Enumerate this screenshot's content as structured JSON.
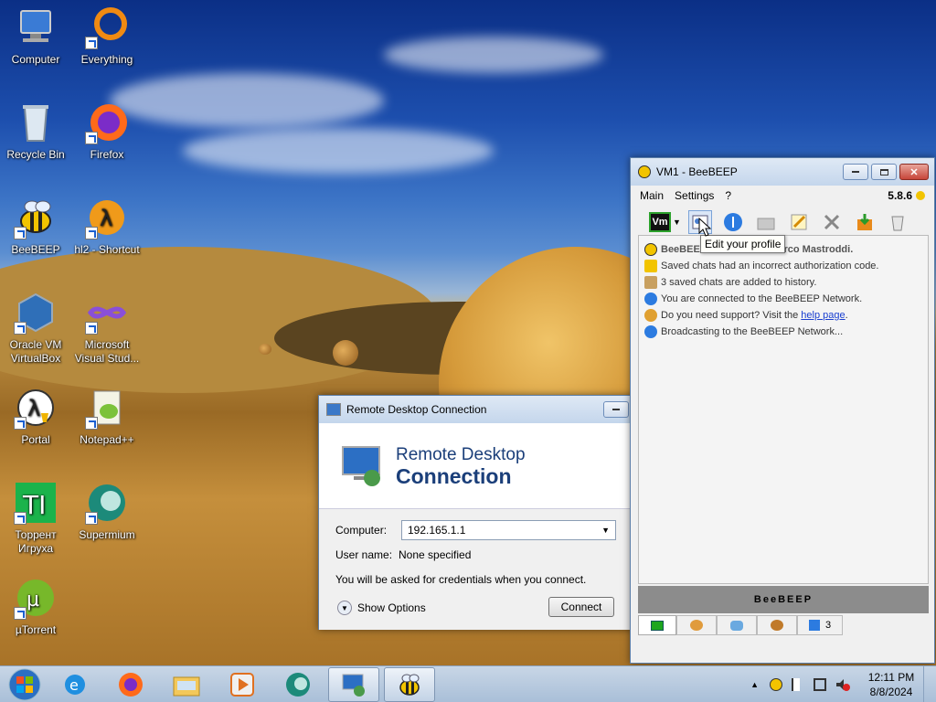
{
  "desktop": {
    "icons": [
      {
        "label": "Computer"
      },
      {
        "label": "Everything"
      },
      {
        "label": "Recycle Bin"
      },
      {
        "label": "Firefox"
      },
      {
        "label": "BeeBEEP"
      },
      {
        "label": "hl2 - Shortcut"
      },
      {
        "label": "Oracle VM VirtualBox"
      },
      {
        "label": "Microsoft Visual Stud..."
      },
      {
        "label": "Portal"
      },
      {
        "label": "Notepad++"
      },
      {
        "label": "Торрент Игруха"
      },
      {
        "label": "Supermium"
      },
      {
        "label": "µTorrent"
      }
    ]
  },
  "rdc": {
    "window_title": "Remote Desktop Connection",
    "banner_line1": "Remote Desktop",
    "banner_line2": "Connection",
    "computer_label": "Computer:",
    "computer_value": "192.165.1.1",
    "username_label": "User name:",
    "username_value": "None specified",
    "credentials_note": "You will be asked for credentials when you connect.",
    "show_options": "Show Options",
    "connect": "Connect"
  },
  "beebeep": {
    "window_title": "VM1 - BeeBEEP",
    "version": "5.8.6",
    "menu": [
      "Main",
      "Settings",
      "?"
    ],
    "tooltip": "Edit your profile",
    "messages": [
      {
        "text": "BeeBEEP 5.8.6 © 2024 Marco Mastroddi.",
        "bold": true
      },
      {
        "text": "Saved chats had an incorrect authorization code."
      },
      {
        "text": "3 saved chats are added to history."
      },
      {
        "text": "You are connected to the BeeBEEP Network."
      },
      {
        "text": "Do you need support? Visit the ",
        "link": "help page",
        "suffix": "."
      },
      {
        "text": "Broadcasting to the BeeBEEP Network..."
      }
    ],
    "status_bar": "BeeBEEP",
    "tab_badge": "3"
  },
  "taskbar": {
    "time": "12:11 PM",
    "date": "8/8/2024"
  },
  "colors": {
    "accent": "#1b3f7a",
    "titlebar": "#c4d6ec",
    "close": "#c7463a"
  }
}
